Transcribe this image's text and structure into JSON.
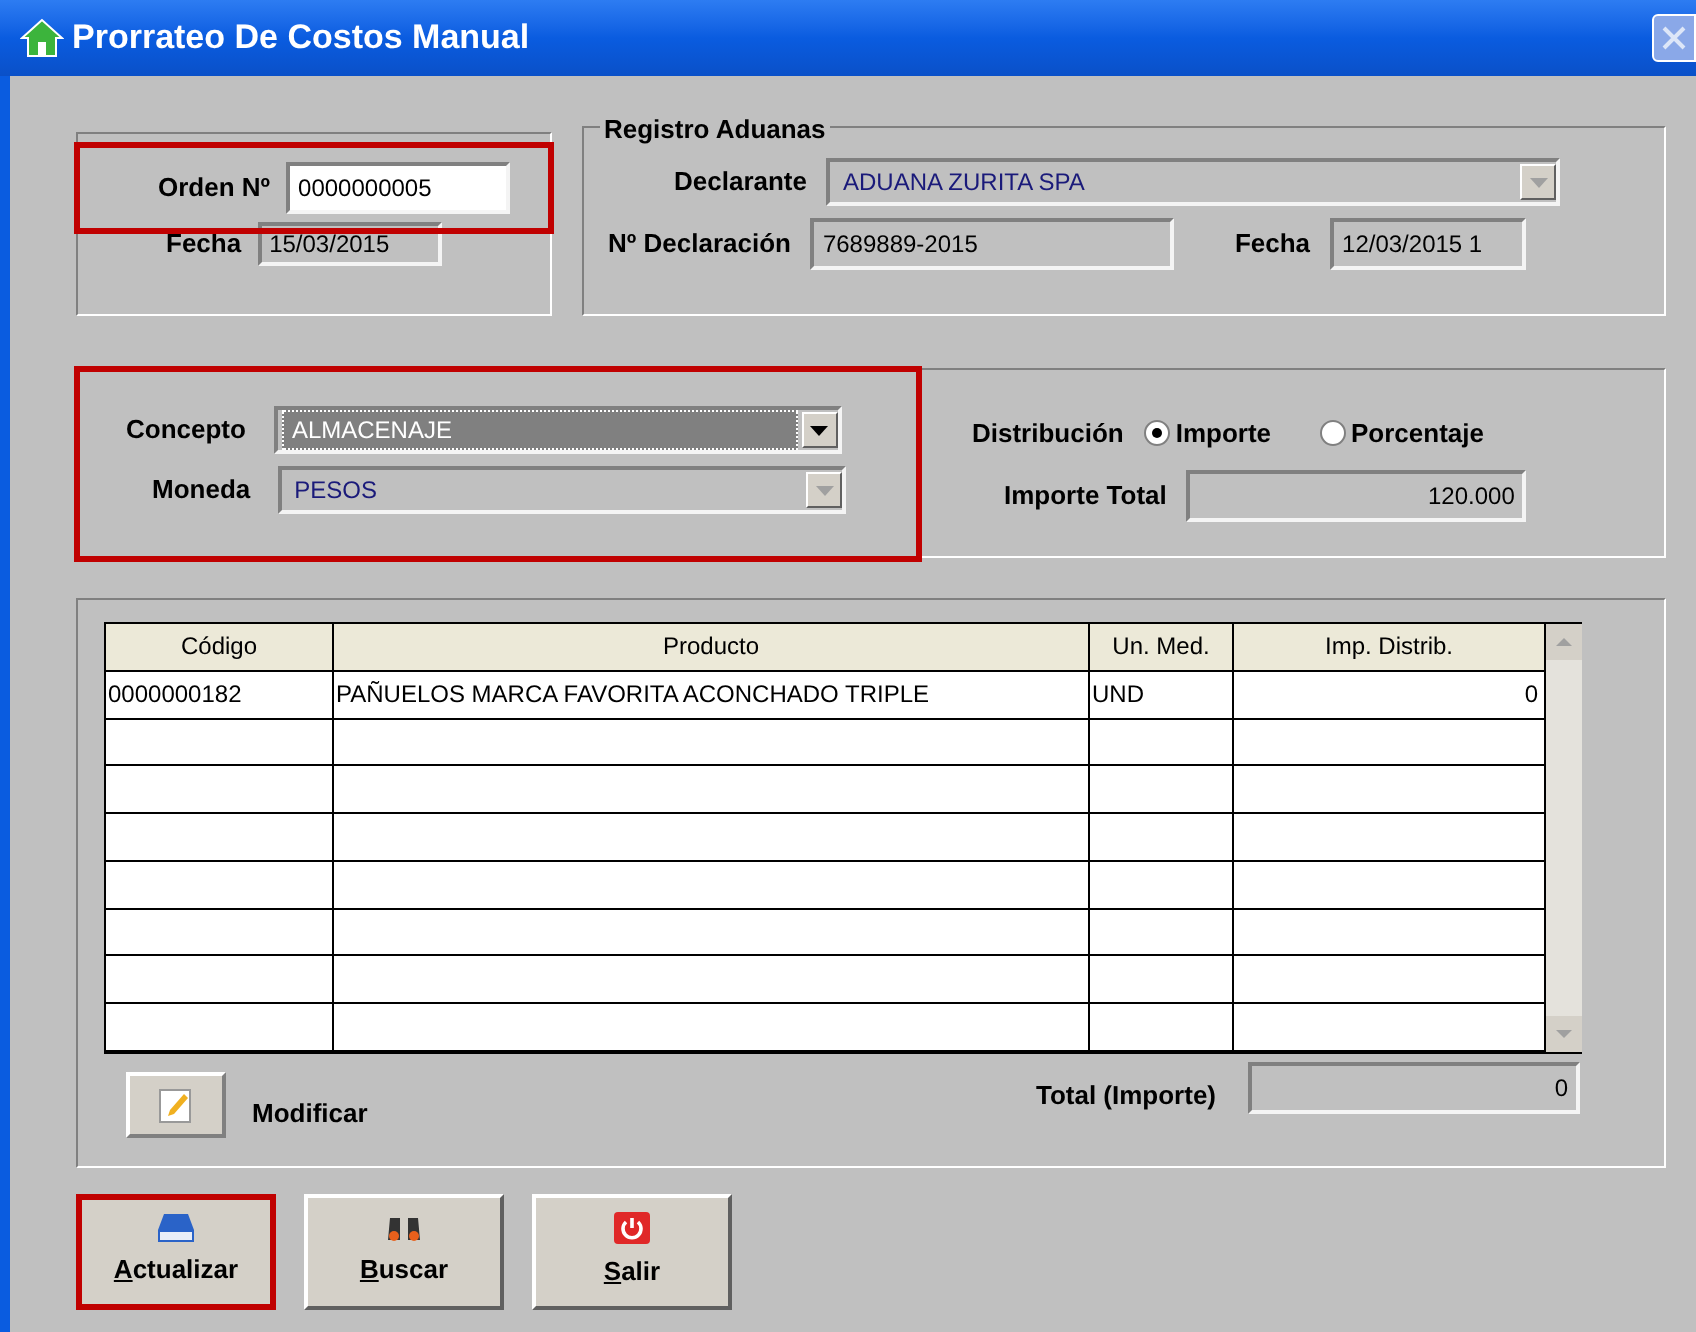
{
  "window": {
    "title": "Prorrateo De Costos Manual"
  },
  "orden": {
    "highlighted": true,
    "orden_label": "Orden Nº",
    "orden_value": "0000000005",
    "fecha_label": "Fecha",
    "fecha_value": "15/03/2015"
  },
  "registro": {
    "title": "Registro Aduanas",
    "declarante_label": "Declarante",
    "declarante": {
      "value": "ADUANA ZURITA SPA",
      "disabled": true
    },
    "declaracion_label": "Nº Declaración",
    "declaracion_value": "7689889-2015",
    "fecha_label": "Fecha",
    "fecha_value": "12/03/2015 1"
  },
  "concepto_group": {
    "highlighted": true,
    "concepto_label": "Concepto",
    "concepto": {
      "value": "ALMACENAJE",
      "disabled": false
    },
    "moneda_label": "Moneda",
    "moneda": {
      "value": "PESOS",
      "disabled": true
    }
  },
  "distribucion": {
    "label": "Distribución",
    "options": [
      {
        "label": "Importe",
        "selected": true
      },
      {
        "label": "Porcentaje",
        "selected": false
      }
    ],
    "total_label": "Importe Total",
    "total_value": "120.000"
  },
  "table": {
    "columns": [
      "Código",
      "Producto",
      "Un. Med.",
      "Imp. Distrib."
    ],
    "rows": [
      [
        "0000000182",
        "PAÑUELOS MARCA FAVORITA ACONCHADO TRIPLE",
        "UND",
        "0"
      ]
    ]
  },
  "modificar": {
    "label": "Modificar"
  },
  "total": {
    "label": "Total (Importe)",
    "value": "0"
  },
  "buttons": [
    {
      "label": "Actualizar",
      "kind": "save",
      "highlighted": true
    },
    {
      "label": "Buscar",
      "kind": "search",
      "highlighted": false
    },
    {
      "label": "Salir",
      "kind": "exit",
      "highlighted": false
    }
  ]
}
